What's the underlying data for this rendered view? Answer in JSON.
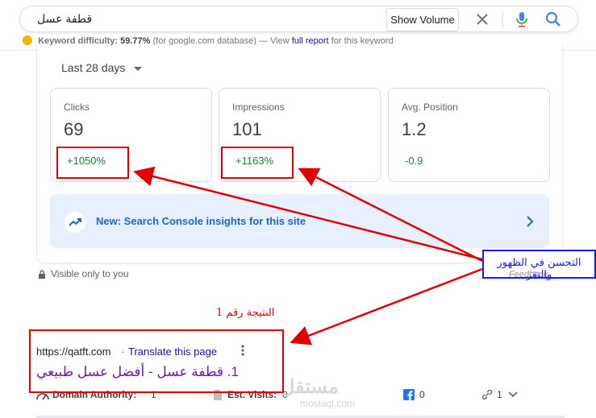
{
  "search": {
    "query": "قطفة عسل",
    "show_volume_label": "Show Volume"
  },
  "keyword_line": {
    "label": "Keyword difficulty:",
    "value": "59.77%",
    "source": "(for google.com database) — View",
    "link": "full report",
    "suffix": "for this keyword"
  },
  "search_console": {
    "period": "Last 28 days",
    "metrics": [
      {
        "label": "Clicks",
        "value": "69",
        "delta": "+1050%"
      },
      {
        "label": "Impressions",
        "value": "101",
        "delta": "+1163%"
      },
      {
        "label": "Avg. Position",
        "value": "1.2",
        "delta": "-0.9"
      }
    ],
    "insight": "New: Search Console insights for this site",
    "visibility_note": "Visible only to you"
  },
  "result": {
    "url": "https://qatft.com",
    "separator": "·",
    "translate": "Translate this page",
    "title": "1. قطفة عسل - أفضل عسل طبيعي",
    "domain_authority_label": "Domain Authority:",
    "domain_authority_value": "1",
    "est_visits_label": "Est. Visits:",
    "est_visits_value": "0",
    "facebook_count": "0",
    "links_count": "1"
  },
  "annotations": {
    "improvement_note": "التحسن في الظهور والنقر",
    "feedback": "Feedback",
    "result_rank": "النتيجة رقم 1"
  },
  "watermark": {
    "main": "مستقل",
    "sub": "mostaql.com"
  },
  "colors": {
    "positive": "#188038",
    "annotation_red": "#e00000",
    "annotation_blue": "#1a1aff",
    "link": "#1a0dab",
    "visited_title": "#681da8"
  }
}
